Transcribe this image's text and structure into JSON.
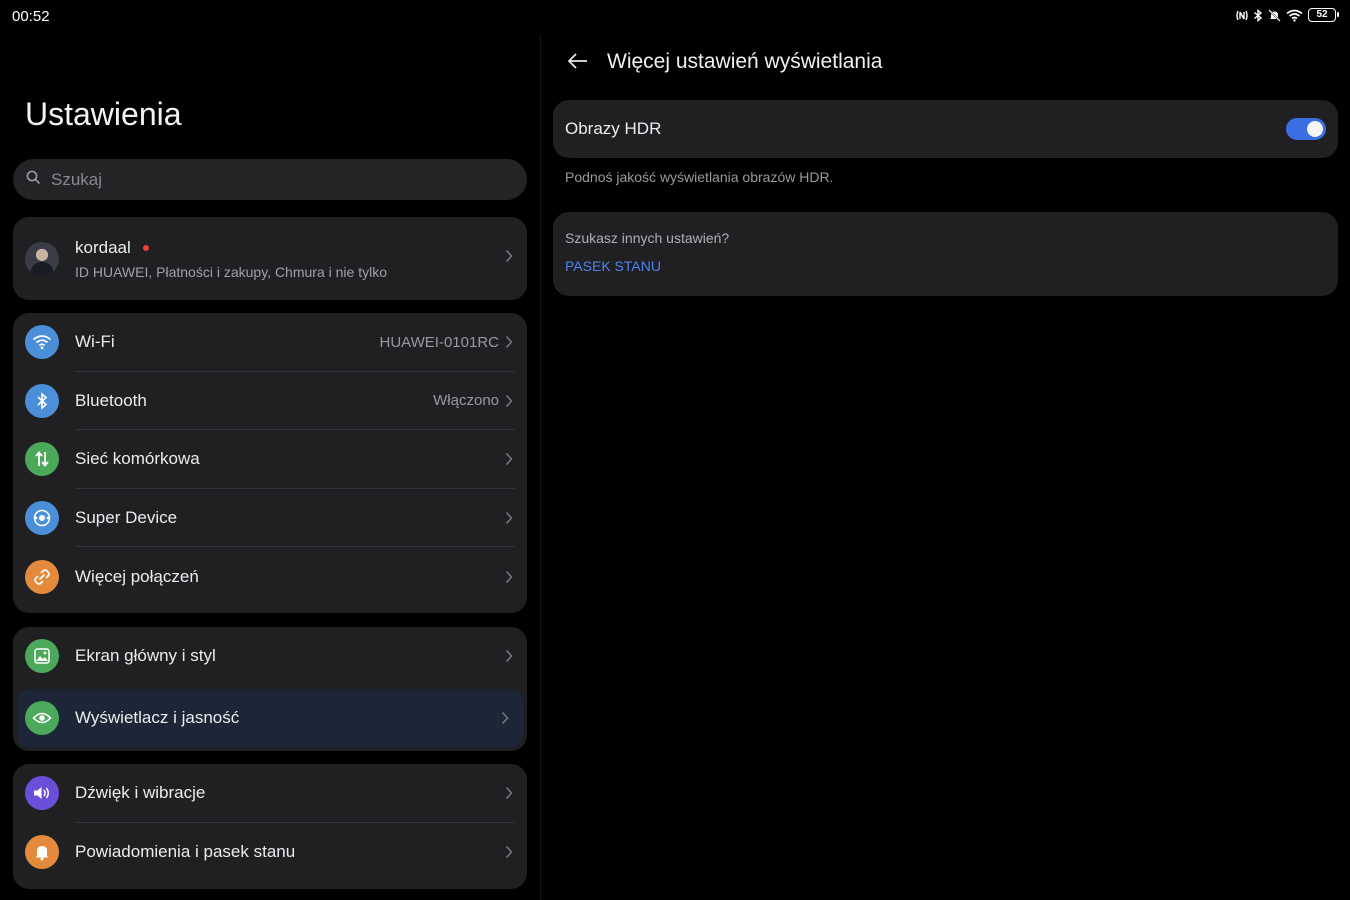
{
  "status_bar": {
    "time": "00:52",
    "battery": "52",
    "icons": [
      "nfc-icon",
      "bluetooth-icon",
      "bell-muted-icon",
      "wifi-icon",
      "battery-icon"
    ]
  },
  "left": {
    "title": "Ustawienia",
    "search_placeholder": "Szukaj",
    "account": {
      "name": "kordaal",
      "subtitle": "ID HUAWEI, Płatności i zakupy, Chmura i nie tylko"
    },
    "connections": [
      {
        "label": "Wi-Fi",
        "value": "HUAWEI-0101RC",
        "icon": "wifi-icon",
        "color": "#4a8fd8"
      },
      {
        "label": "Bluetooth",
        "value": "Włączono",
        "icon": "bluetooth-icon",
        "color": "#4a8fd8"
      },
      {
        "label": "Sieć komórkowa",
        "value": "",
        "icon": "mobile-data-icon",
        "color": "#4ca85a"
      },
      {
        "label": "Super Device",
        "value": "",
        "icon": "super-device-icon",
        "color": "#4a8fd8"
      },
      {
        "label": "Więcej połączeń",
        "value": "",
        "icon": "link-icon",
        "color": "#e38a3c"
      }
    ],
    "style": [
      {
        "label": "Ekran główny i styl",
        "icon": "image-icon",
        "color": "#4ca85a"
      },
      {
        "label": "Wyświetlacz i jasność",
        "icon": "eye-icon",
        "color": "#4ca85a",
        "selected": true
      }
    ],
    "sound": [
      {
        "label": "Dźwięk i wibracje",
        "icon": "speaker-icon",
        "color": "#6a4fd8"
      },
      {
        "label": "Powiadomienia i pasek stanu",
        "icon": "bell-icon",
        "color": "#e38a3c"
      }
    ]
  },
  "right": {
    "title": "Więcej ustawień wyświetlania",
    "hdr_label": "Obrazy HDR",
    "hdr_enabled": true,
    "hdr_description": "Podnoś jakość wyświetlania obrazów HDR.",
    "more_question": "Szukasz innych ustawień?",
    "more_link": "PASEK STANU"
  },
  "colors": {
    "accent": "#3b6ee0",
    "link": "#4f83f0",
    "card_bg": "#202023",
    "selected_bg": "#1c2636"
  }
}
